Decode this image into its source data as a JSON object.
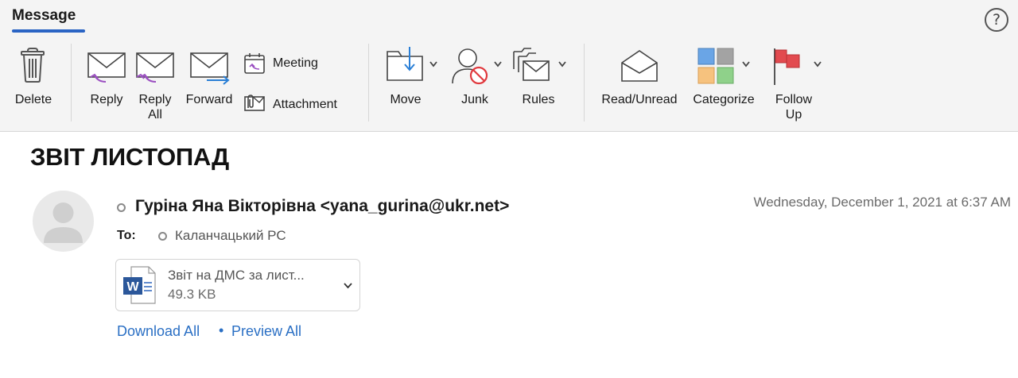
{
  "toolbar": {
    "tab_label": "Message",
    "help_label": "?",
    "buttons": {
      "delete": "Delete",
      "reply": "Reply",
      "reply_all_line1": "Reply",
      "reply_all_line2": "All",
      "forward": "Forward",
      "meeting": "Meeting",
      "attachment": "Attachment",
      "move": "Move",
      "junk": "Junk",
      "rules": "Rules",
      "read_unread": "Read/Unread",
      "categorize": "Categorize",
      "follow_up_line1": "Follow",
      "follow_up_line2": "Up"
    },
    "icons": {
      "delete": "trash-icon",
      "reply": "reply-icon",
      "reply_all": "reply-all-icon",
      "forward": "forward-icon",
      "meeting": "calendar-reply-icon",
      "attachment": "paperclip-envelope-icon",
      "move": "folder-move-icon",
      "junk": "person-block-icon",
      "rules": "rules-envelope-icon",
      "read_unread": "open-envelope-icon",
      "categorize": "category-grid-icon",
      "follow_up": "flag-icon"
    },
    "colors": {
      "accent": "#2a64c4",
      "reply_arrow": "#9b4fc1",
      "forward_arrow": "#2a7fd6",
      "junk_block": "#e0393e",
      "flag": "#e24a4f",
      "category_blue": "#6aa5e6",
      "category_gray": "#a3a3a3",
      "category_orange": "#f6c27e",
      "category_green": "#8fd18a"
    }
  },
  "message": {
    "subject": "ЗВІТ ЛИСТОПАД",
    "sender": "Гуріна Яна Вікторівна <yana_gurina@ukr.net>",
    "date": "Wednesday, December 1, 2021 at 6:37 AM",
    "to_label": "To:",
    "to_name": "Каланчацький РС",
    "attachment": {
      "name": "Звіт на ДМС за лист...",
      "size": "49.3 KB",
      "icon": "word-document-icon"
    },
    "links": {
      "download_all": "Download All",
      "separator": "•",
      "preview_all": "Preview All"
    },
    "colors": {
      "link": "#2a6fc4"
    }
  }
}
